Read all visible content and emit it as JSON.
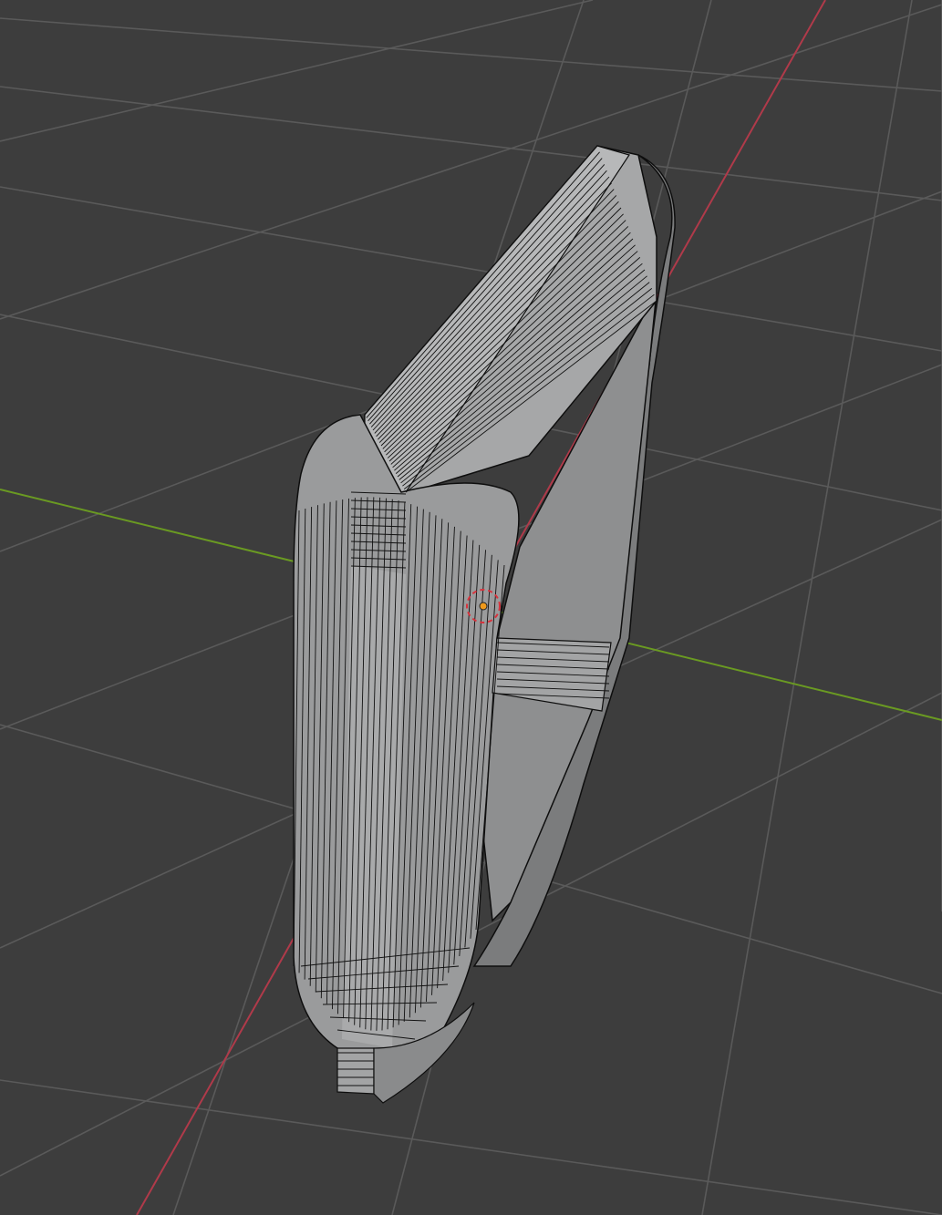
{
  "viewport": {
    "name": "3D Viewport",
    "background": "#3d3d3d",
    "grid_color": "#585858",
    "x_axis_color": "#b03a4a",
    "y_axis_color": "#6a9a22",
    "mesh": {
      "fill": "#9a9b9c",
      "fill_light": "#b4b5b6",
      "fill_dark": "#7b7c7d",
      "wire": "#0e0e0e",
      "origin_color": "#f09a1c",
      "cursor_color": "#d8323c"
    }
  }
}
